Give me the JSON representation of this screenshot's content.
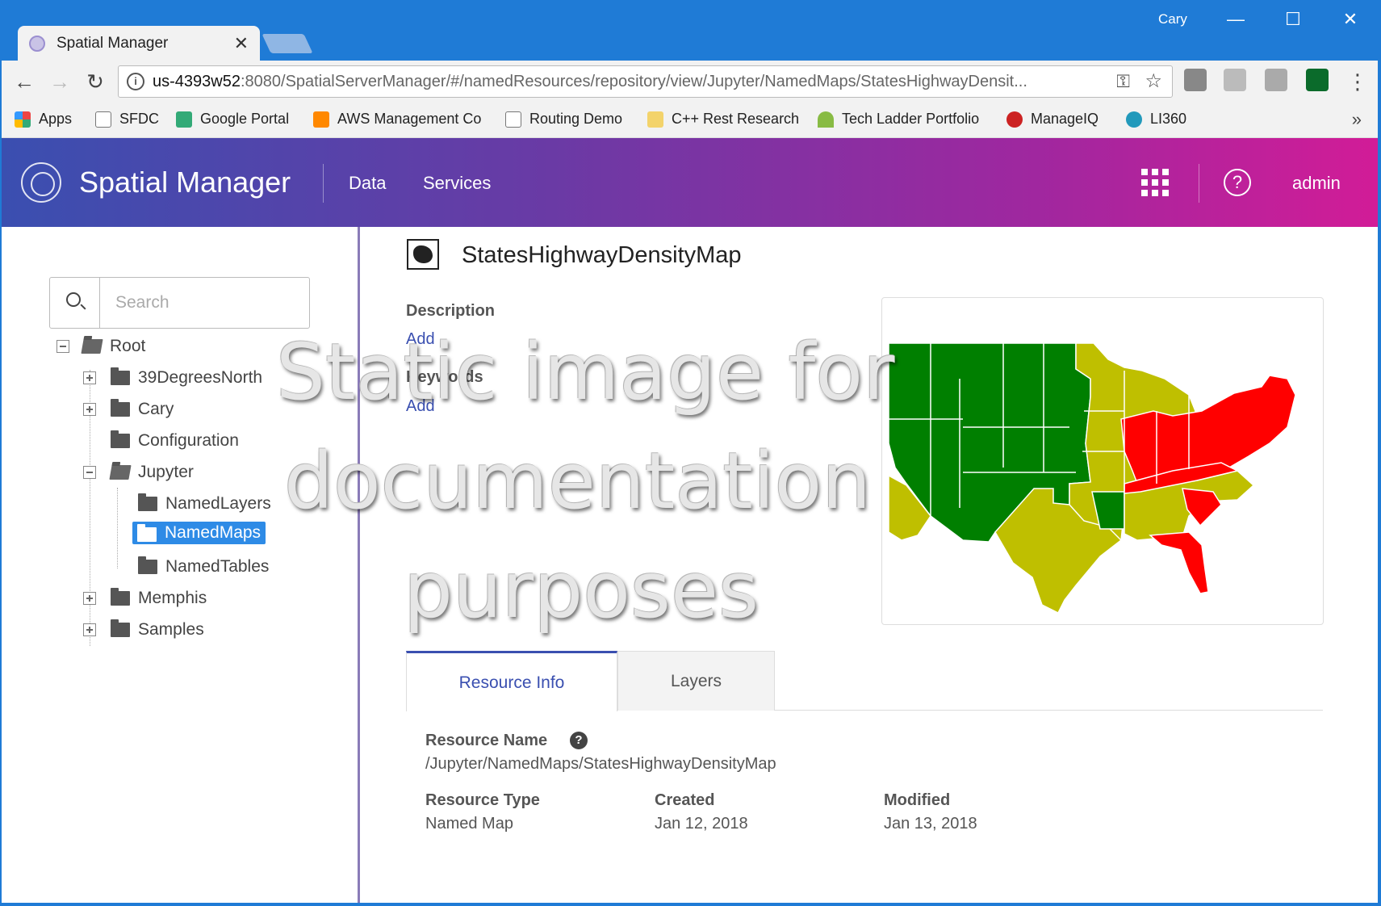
{
  "window": {
    "user": "Cary",
    "minimize": "—",
    "maximize": "☐",
    "close": "✕"
  },
  "browser_tab": {
    "title": "Spatial Manager",
    "close": "✕"
  },
  "toolbar": {
    "back": "←",
    "forward": "→",
    "reload": "↻",
    "url_host": "us-4393w52",
    "url_rest": ":8080/SpatialServerManager/#/namedResources/repository/view/Jupyter/NamedMaps/StatesHighwayDensit...",
    "info": "i",
    "key": "⚿",
    "star": "☆",
    "menu": "⋮"
  },
  "bookmarks": [
    {
      "label": "Apps",
      "color": "#e44"
    },
    {
      "label": "SFDC",
      "color": "#ddd"
    },
    {
      "label": "Google Portal",
      "color": "#3a7"
    },
    {
      "label": "AWS Management Co",
      "color": "#f80"
    },
    {
      "label": "Routing Demo",
      "color": "#ddd"
    },
    {
      "label": "C++ Rest Research",
      "color": "#f3d36b"
    },
    {
      "label": "Tech Ladder Portfolio",
      "color": "#8b4"
    },
    {
      "label": "ManageIQ",
      "color": "#c22"
    },
    {
      "label": "LI360",
      "color": "#29b"
    }
  ],
  "bookmarks_more": "»",
  "header": {
    "app_title": "Spatial Manager",
    "nav": [
      "Data",
      "Services"
    ],
    "help": "?",
    "user": "admin"
  },
  "sidebar": {
    "search_placeholder": "Search",
    "tree": {
      "root": "Root",
      "items": [
        "39DegreesNorth",
        "Cary",
        "Configuration",
        "Jupyter",
        "Memphis",
        "Samples"
      ],
      "jupyter_children": [
        "NamedLayers",
        "NamedMaps",
        "NamedTables"
      ],
      "selected": "NamedMaps"
    }
  },
  "resource": {
    "title": "StatesHighwayDensityMap",
    "description_label": "Description",
    "description_add": "Add",
    "keywords_label": "Keywords",
    "keywords_add": "Add"
  },
  "tabs": [
    "Resource Info",
    "Layers"
  ],
  "info": {
    "name_label": "Resource Name",
    "name_value": "/Jupyter/NamedMaps/StatesHighwayDensityMap",
    "type_label": "Resource Type",
    "type_value": "Named Map",
    "created_label": "Created",
    "created_value": "Jan 12, 2018",
    "modified_label": "Modified",
    "modified_value": "Jan 13, 2018",
    "help": "?"
  },
  "map_colors": {
    "low": "#007f00",
    "mid": "#bfbf00",
    "high": "#ff0000"
  },
  "watermark": [
    "Static image for",
    "documentation",
    "purposes"
  ]
}
